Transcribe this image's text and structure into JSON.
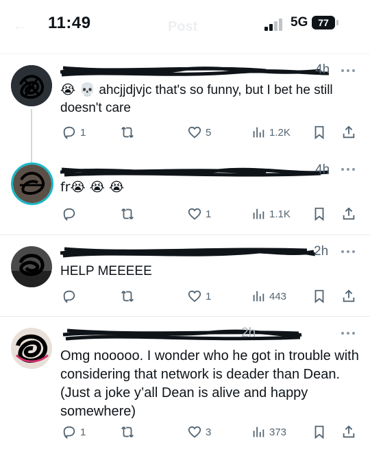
{
  "status_bar": {
    "time": "11:49",
    "network": "5G",
    "battery": "77",
    "ghost_title": "Post"
  },
  "tweets": [
    {
      "time_ago": "4h",
      "text": "😭 💀 ahcjjdjvjc that's so funny, but I bet he still doesn't care",
      "replies": "1",
      "reposts": "",
      "likes": "5",
      "views": "1.2K"
    },
    {
      "time_ago": "4h",
      "text": "fr😭 😭 😭",
      "replies": "",
      "reposts": "",
      "likes": "1",
      "views": "1.1K"
    },
    {
      "time_ago": "2h",
      "text": "HELP MEEEEE",
      "replies": "",
      "reposts": "",
      "likes": "1",
      "views": "443"
    },
    {
      "time_ago": "2h",
      "text": "Omg nooooo. I wonder who he got in trouble with considering that network is deader than Dean. (Just a joke y’all Dean is alive and happy somewhere)",
      "replies": "1",
      "reposts": "",
      "likes": "3",
      "views": "373"
    }
  ],
  "icons": {
    "reply": "reply-icon",
    "repost": "repost-icon",
    "like": "heart-icon",
    "views": "views-icon",
    "bookmark": "bookmark-icon",
    "share": "share-icon"
  },
  "colors": {
    "text": "#0f1419",
    "secondary": "#536471",
    "divider": "#e6ecf0"
  }
}
